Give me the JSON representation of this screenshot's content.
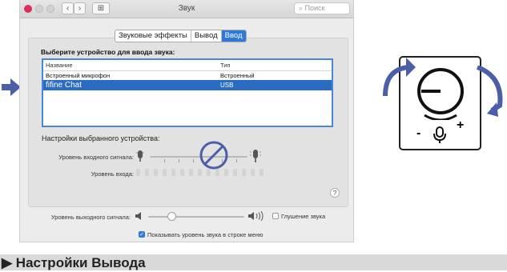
{
  "window": {
    "title": "Звук",
    "search_placeholder": "Поиск",
    "nav": {
      "back": "‹",
      "forward": "›",
      "grid": "⊞"
    }
  },
  "tabs": [
    {
      "label": "Звуковые эффекты",
      "active": false
    },
    {
      "label": "Вывод",
      "active": false
    },
    {
      "label": "Ввод",
      "active": true
    }
  ],
  "input_panel": {
    "heading": "Выберите устройство для ввода звука:",
    "columns": {
      "name": "Название",
      "type": "Тип"
    },
    "devices": [
      {
        "name": "Встроенный микрофон",
        "type": "Встроенный",
        "selected": false
      },
      {
        "name": "fifine Chat",
        "type": "USB",
        "selected": true
      }
    ],
    "settings_title": "Настройки выбранного устройства:",
    "input_volume_label": "Уровень входного сигнала:",
    "input_level_label": "Уровень входа:",
    "help": "?"
  },
  "output": {
    "volume_label": "Уровень выходного сигнала:",
    "mute_label": "Глушение звука",
    "menu_checkbox_label": "Показывать уровень звука в строке меню",
    "menu_checkbox_checked": true
  },
  "footer": {
    "title": "▶ Настройки Вывода"
  },
  "device_panel": {
    "minus": "-",
    "plus": "+"
  },
  "colors": {
    "accent": "#2f7ad9",
    "arrow": "#4a5fa8",
    "selected_row": "#2a6cc4"
  }
}
